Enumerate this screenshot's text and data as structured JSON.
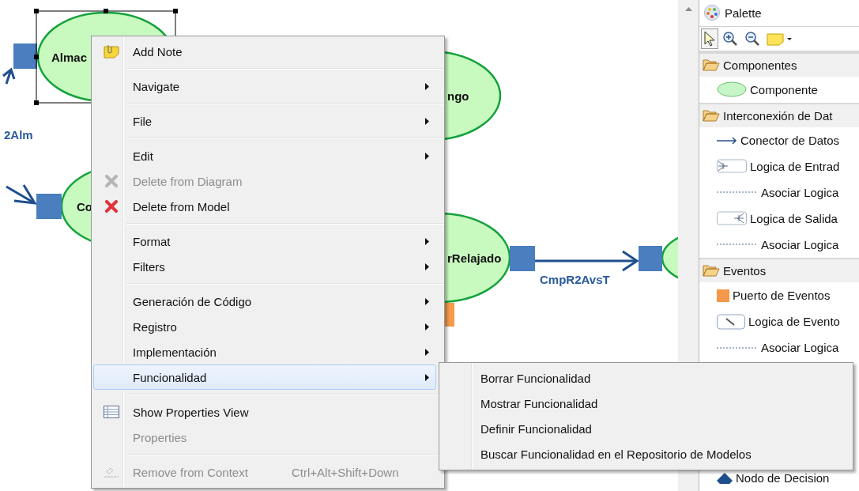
{
  "diagram": {
    "nodes": [
      {
        "label": "Almac",
        "selected": true
      },
      {
        "label": "Co",
        "selected": false
      },
      {
        "label": "ngo",
        "selected": false
      },
      {
        "label": "rRelajado",
        "selected": false
      },
      {
        "selected": false
      }
    ],
    "connector_labels": [
      "2Alm",
      "CmpR2AvsT"
    ]
  },
  "context_menu": {
    "items": [
      {
        "kind": "item",
        "label": "Add Note",
        "disabled": false,
        "selected": false,
        "submenu": false
      },
      {
        "kind": "separator"
      },
      {
        "kind": "item",
        "label": "Navigate",
        "disabled": false,
        "selected": false,
        "submenu": true
      },
      {
        "kind": "separator"
      },
      {
        "kind": "item",
        "label": "File",
        "disabled": false,
        "selected": false,
        "submenu": true
      },
      {
        "kind": "separator"
      },
      {
        "kind": "item",
        "label": "Edit",
        "disabled": false,
        "selected": false,
        "submenu": true
      },
      {
        "kind": "item",
        "label": "Delete from Diagram",
        "disabled": true,
        "selected": false,
        "submenu": false
      },
      {
        "kind": "item",
        "label": "Delete from Model",
        "disabled": false,
        "selected": false,
        "submenu": false
      },
      {
        "kind": "separator"
      },
      {
        "kind": "item",
        "label": "Format",
        "disabled": false,
        "selected": false,
        "submenu": true
      },
      {
        "kind": "item",
        "label": "Filters",
        "disabled": false,
        "selected": false,
        "submenu": true
      },
      {
        "kind": "separator"
      },
      {
        "kind": "item",
        "label": "Generación de Código",
        "disabled": false,
        "selected": false,
        "submenu": true
      },
      {
        "kind": "item",
        "label": "Registro",
        "disabled": false,
        "selected": false,
        "submenu": true
      },
      {
        "kind": "item",
        "label": "Implementación",
        "disabled": false,
        "selected": false,
        "submenu": true
      },
      {
        "kind": "item",
        "label": "Funcionalidad",
        "disabled": false,
        "selected": true,
        "submenu": true
      },
      {
        "kind": "separator"
      },
      {
        "kind": "item",
        "label": "Show Properties View",
        "disabled": false,
        "selected": false,
        "submenu": false
      },
      {
        "kind": "item",
        "label": "Properties",
        "disabled": true,
        "selected": false,
        "submenu": false
      },
      {
        "kind": "separator"
      },
      {
        "kind": "item",
        "label": "Remove from Context",
        "disabled": true,
        "selected": false,
        "submenu": false,
        "shortcut": "Ctrl+Alt+Shift+Down"
      }
    ]
  },
  "submenu": {
    "items": [
      {
        "label": "Borrar Funcionalidad",
        "selected": false
      },
      {
        "label": "Mostrar Funcionalidad",
        "selected": false
      },
      {
        "label": "Definir Funcionalidad",
        "selected": false
      },
      {
        "label": "Buscar Funcionalidad en el Repositorio de Modelos",
        "selected": false
      }
    ]
  },
  "palette": {
    "title": "Palette",
    "tools": [
      {
        "selected": true
      },
      {
        "selected": false
      },
      {
        "selected": false
      },
      {
        "selected": false
      }
    ],
    "drawers": [
      {
        "label": "Componentes",
        "expanded": true,
        "entries": [
          {
            "kind": "ellipse",
            "label": "Componente"
          }
        ]
      },
      {
        "label": "Interconexión de Dat",
        "expanded": true,
        "entries": [
          {
            "kind": "arrow",
            "label": "Conector de Datos"
          },
          {
            "kind": "input-logic",
            "label": "Logica de Entrad"
          },
          {
            "kind": "dotted",
            "label": "Asociar Logica"
          },
          {
            "kind": "output-logic",
            "label": "Logica de Salida"
          },
          {
            "kind": "dotted",
            "label": "Asociar Logica"
          }
        ]
      },
      {
        "label": "Eventos",
        "expanded": true,
        "entries": [
          {
            "kind": "square",
            "label": "Puerto de Eventos"
          },
          {
            "kind": "event-logic",
            "label": "Logica de Evento"
          },
          {
            "kind": "dotted",
            "label": "Asociar Logica"
          },
          {
            "kind": "hidden"
          },
          {
            "kind": "diamond",
            "label": "Nodo de Decision"
          }
        ]
      }
    ]
  }
}
